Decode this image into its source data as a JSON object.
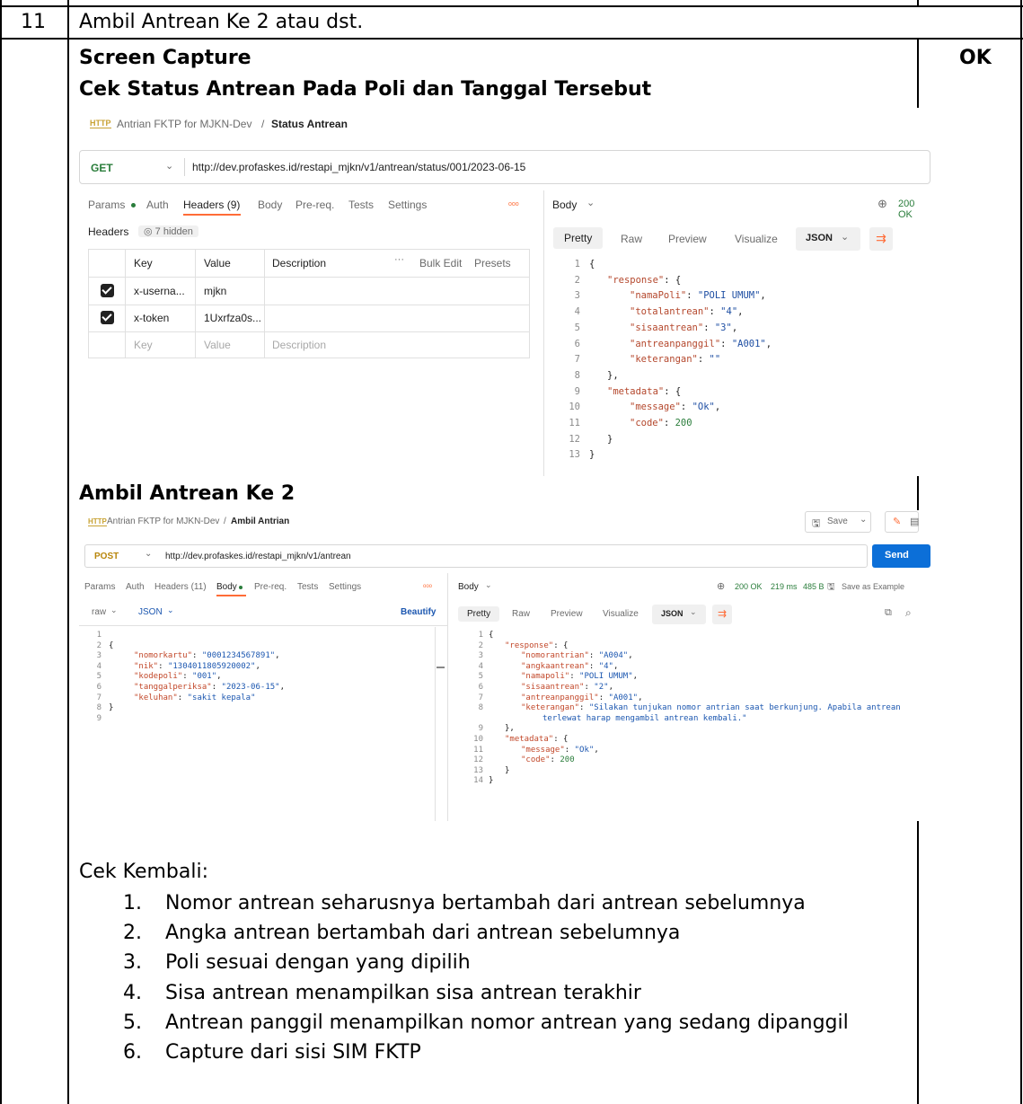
{
  "row": {
    "number": "11",
    "title": "Ambil Antrean Ke 2 atau dst.",
    "status": "OK"
  },
  "section1": {
    "heading1": "Screen Capture",
    "heading2": "Cek Status Antrean Pada Poli dan Tanggal Tersebut"
  },
  "shot1": {
    "breadcrumb_collection": "Antrian FKTP for MJKN-Dev",
    "breadcrumb_sep": "/",
    "breadcrumb_request": "Status Antrean",
    "method": "GET",
    "url": "http://dev.profaskes.id/restapi_mjkn/v1/antrean/status/001/2023-06-15",
    "tabs": [
      "Params",
      "Auth",
      "Headers (9)",
      "Body",
      "Pre-req.",
      "Tests",
      "Settings"
    ],
    "more": "ooo",
    "headers_label": "Headers",
    "hidden_label": "7 hidden",
    "cols": [
      "Key",
      "Value",
      "Description"
    ],
    "bulk_edit": "Bulk Edit",
    "presets": "Presets",
    "rows": [
      {
        "key": "x-userna...",
        "value": "mjkn"
      },
      {
        "key": "x-token",
        "value": "1Uxrfza0s..."
      }
    ],
    "placeholder": {
      "key": "Key",
      "value": "Value",
      "desc": "Description"
    },
    "body_label": "Body",
    "status": "200 OK",
    "view_tabs": [
      "Pretty",
      "Raw",
      "Preview",
      "Visualize"
    ],
    "format": "JSON",
    "code": [
      {
        "n": "1",
        "t": "{"
      },
      {
        "n": "2",
        "k": "\"response\"",
        "r": ": {"
      },
      {
        "n": "3",
        "k": "\"namaPoli\"",
        "r": ": ",
        "v": "\"POLI UMUM\"",
        "e": ","
      },
      {
        "n": "4",
        "k": "\"totalantrean\"",
        "r": ": ",
        "v": "\"4\"",
        "e": ","
      },
      {
        "n": "5",
        "k": "\"sisaantrean\"",
        "r": ": ",
        "v": "\"3\"",
        "e": ","
      },
      {
        "n": "6",
        "k": "\"antreanpanggil\"",
        "r": ": ",
        "v": "\"A001\"",
        "e": ","
      },
      {
        "n": "7",
        "k": "\"keterangan\"",
        "r": ": ",
        "v": "\"\"",
        "e": ""
      },
      {
        "n": "8",
        "t": "},"
      },
      {
        "n": "9",
        "k": "\"metadata\"",
        "r": ": {"
      },
      {
        "n": "10",
        "k": "\"message\"",
        "r": ": ",
        "v": "\"Ok\"",
        "e": ","
      },
      {
        "n": "11",
        "k": "\"code\"",
        "r": ": ",
        "num": "200",
        "e": ""
      },
      {
        "n": "12",
        "t": "}"
      },
      {
        "n": "13",
        "t": "}"
      }
    ]
  },
  "section2": {
    "heading": "Ambil Antrean Ke 2"
  },
  "shot2": {
    "breadcrumb_collection": "Antrian FKTP for MJKN-Dev",
    "breadcrumb_sep": "/",
    "breadcrumb_request": "Ambil Antrian",
    "save": "Save",
    "method": "POST",
    "url": "http://dev.profaskes.id/restapi_mjkn/v1/antrean",
    "send": "Send",
    "tabs": [
      "Params",
      "Auth",
      "Headers (11)",
      "Body",
      "Pre-req.",
      "Tests",
      "Settings"
    ],
    "more": "ooo",
    "raw": "raw",
    "format": "JSON",
    "beautify": "Beautify",
    "body_label": "Body",
    "status": "200 OK",
    "time": "219 ms",
    "size": "485 B",
    "save_example": "Save as Example",
    "view_tabs": [
      "Pretty",
      "Raw",
      "Preview",
      "Visualize"
    ],
    "req_code": [
      {
        "n": "1",
        "t": ""
      },
      {
        "n": "2",
        "t": "{"
      },
      {
        "n": "3",
        "k": "\"nomorkartu\"",
        "r": ": ",
        "v": "\"0001234567891\"",
        "e": ","
      },
      {
        "n": "4",
        "k": "\"nik\"",
        "r": ": ",
        "v": "\"1304011805920002\"",
        "e": ","
      },
      {
        "n": "5",
        "k": "\"kodepoli\"",
        "r": ": ",
        "v": "\"001\"",
        "e": ","
      },
      {
        "n": "6",
        "k": "\"tanggalperiksa\"",
        "r": ": ",
        "v": "\"2023-06-15\"",
        "e": ","
      },
      {
        "n": "7",
        "k": "\"keluhan\"",
        "r": ": ",
        "v": "\"sakit kepala\"",
        "e": ""
      },
      {
        "n": "8",
        "t": "}"
      },
      {
        "n": "9",
        "t": ""
      }
    ],
    "resp_code": [
      {
        "n": "1",
        "t": "{"
      },
      {
        "n": "2",
        "k": "\"response\"",
        "r": ": {"
      },
      {
        "n": "3",
        "k": "\"nomorantrian\"",
        "r": ": ",
        "v": "\"A004\"",
        "e": ","
      },
      {
        "n": "4",
        "k": "\"angkaantrean\"",
        "r": ": ",
        "v": "\"4\"",
        "e": ","
      },
      {
        "n": "5",
        "k": "\"namapoli\"",
        "r": ": ",
        "v": "\"POLI UMUM\"",
        "e": ","
      },
      {
        "n": "6",
        "k": "\"sisaantrean\"",
        "r": ": ",
        "v": "\"2\"",
        "e": ","
      },
      {
        "n": "7",
        "k": "\"antreanpanggil\"",
        "r": ": ",
        "v": "\"A001\"",
        "e": ","
      },
      {
        "n": "8",
        "k": "\"keterangan\"",
        "r": ": ",
        "v": "\"Silakan tunjukan nomor antrian saat berkunjung. Apabila antrean",
        "e": ""
      },
      {
        "n": "",
        "v": "terlewat harap mengambil antrean kembali.\"",
        "e": ""
      },
      {
        "n": "9",
        "t": "},"
      },
      {
        "n": "10",
        "k": "\"metadata\"",
        "r": ": {"
      },
      {
        "n": "11",
        "k": "\"message\"",
        "r": ": ",
        "v": "\"Ok\"",
        "e": ","
      },
      {
        "n": "12",
        "k": "\"code\"",
        "r": ": ",
        "num": "200",
        "e": ""
      },
      {
        "n": "13",
        "t": "}"
      },
      {
        "n": "14",
        "t": "}"
      }
    ]
  },
  "checklist": {
    "heading": "Cek Kembali:",
    "items": [
      {
        "num": "1.",
        "text": "Nomor antrean seharusnya bertambah dari antrean sebelumnya"
      },
      {
        "num": "2.",
        "text": "Angka antrean bertambah dari antrean sebelumnya"
      },
      {
        "num": "3.",
        "text": "Poli sesuai dengan yang dipilih"
      },
      {
        "num": "4.",
        "text": "Sisa antrean menampilkan sisa antrean terakhir"
      },
      {
        "num": "5.",
        "text": "Antrean panggil menampilkan nomor antrean yang sedang dipanggil"
      },
      {
        "num": "6.",
        "text": "Capture  dari sisi SIM FKTP"
      }
    ]
  },
  "colors": {
    "accent": "#ff6c37",
    "send": "#0c6fd8",
    "border": "#000000"
  }
}
